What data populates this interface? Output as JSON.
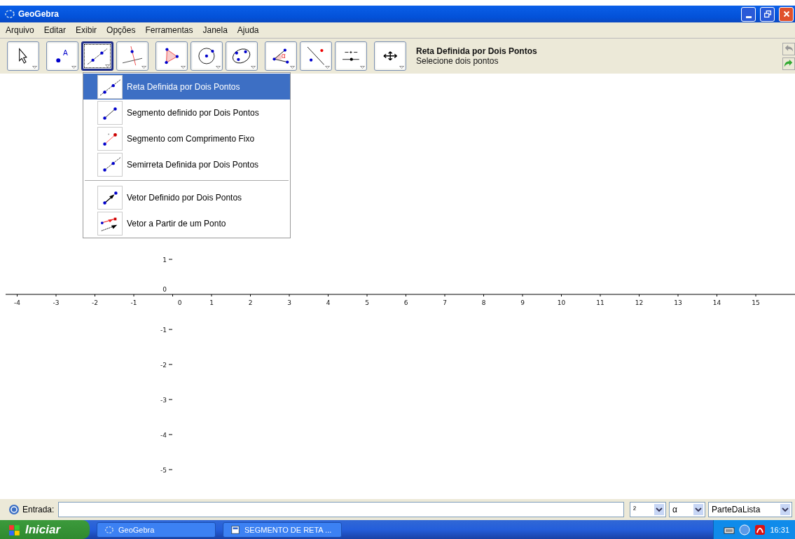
{
  "window": {
    "title": "GeoGebra"
  },
  "menu_bar": [
    "Arquivo",
    "Editar",
    "Exibir",
    "Opções",
    "Ferramentas",
    "Janela",
    "Ajuda"
  ],
  "toolbar": {
    "groups": [
      [
        {
          "kind": "move",
          "selected": false
        }
      ],
      [
        {
          "kind": "point",
          "glyph": "A",
          "selected": false
        },
        {
          "kind": "line",
          "selected": true
        },
        {
          "kind": "perpendicular",
          "selected": false
        }
      ],
      [
        {
          "kind": "polygon",
          "selected": false
        },
        {
          "kind": "circle",
          "selected": false
        },
        {
          "kind": "conic",
          "selected": false
        }
      ],
      [
        {
          "kind": "angle",
          "glyph": "α",
          "selected": false
        },
        {
          "kind": "reflect",
          "selected": false
        },
        {
          "kind": "slider",
          "selected": false
        }
      ],
      [
        {
          "kind": "move_view",
          "selected": false
        }
      ]
    ]
  },
  "tool_info": {
    "name": "Reta Definida por Dois Pontos",
    "hint": "Selecione dois pontos"
  },
  "tool_menu": {
    "sections": [
      [
        {
          "kind": "line",
          "label": "Reta Definida por Dois Pontos",
          "selected": true
        },
        {
          "kind": "segment",
          "label": "Segmento definido por Dois Pontos",
          "selected": false
        },
        {
          "kind": "segment_fixed",
          "label": "Segmento com Comprimento Fixo",
          "selected": false
        },
        {
          "kind": "ray",
          "label": "Semirreta Definida por Dois Pontos",
          "selected": false
        }
      ],
      [
        {
          "kind": "vector",
          "label": "Vetor Definido por Dois Pontos",
          "selected": false
        },
        {
          "kind": "vector_from_point",
          "label": "Vetor a Partir de um Ponto",
          "selected": false
        }
      ]
    ]
  },
  "graphics": {
    "x_axis_labels": [
      "-4",
      "-3",
      "-2",
      "-1",
      "0",
      "1",
      "2",
      "3",
      "4",
      "5",
      "6",
      "7",
      "8",
      "9",
      "10",
      "11",
      "12",
      "13",
      "14",
      "15"
    ],
    "y_axis_labels": [
      "1",
      "0",
      "-1",
      "-2",
      "-3",
      "-4",
      "-5"
    ]
  },
  "input_bar": {
    "label": "Entrada:",
    "symbol_dropdown": "²",
    "greek_dropdown": "α",
    "command_dropdown": "ParteDaLista"
  },
  "taskbar": {
    "start": "Iniciar",
    "tasks": [
      {
        "kind": "app",
        "label": "GeoGebra"
      },
      {
        "kind": "document",
        "label": "SEGMENTO DE RETA ..."
      }
    ],
    "clock": "16:31"
  }
}
